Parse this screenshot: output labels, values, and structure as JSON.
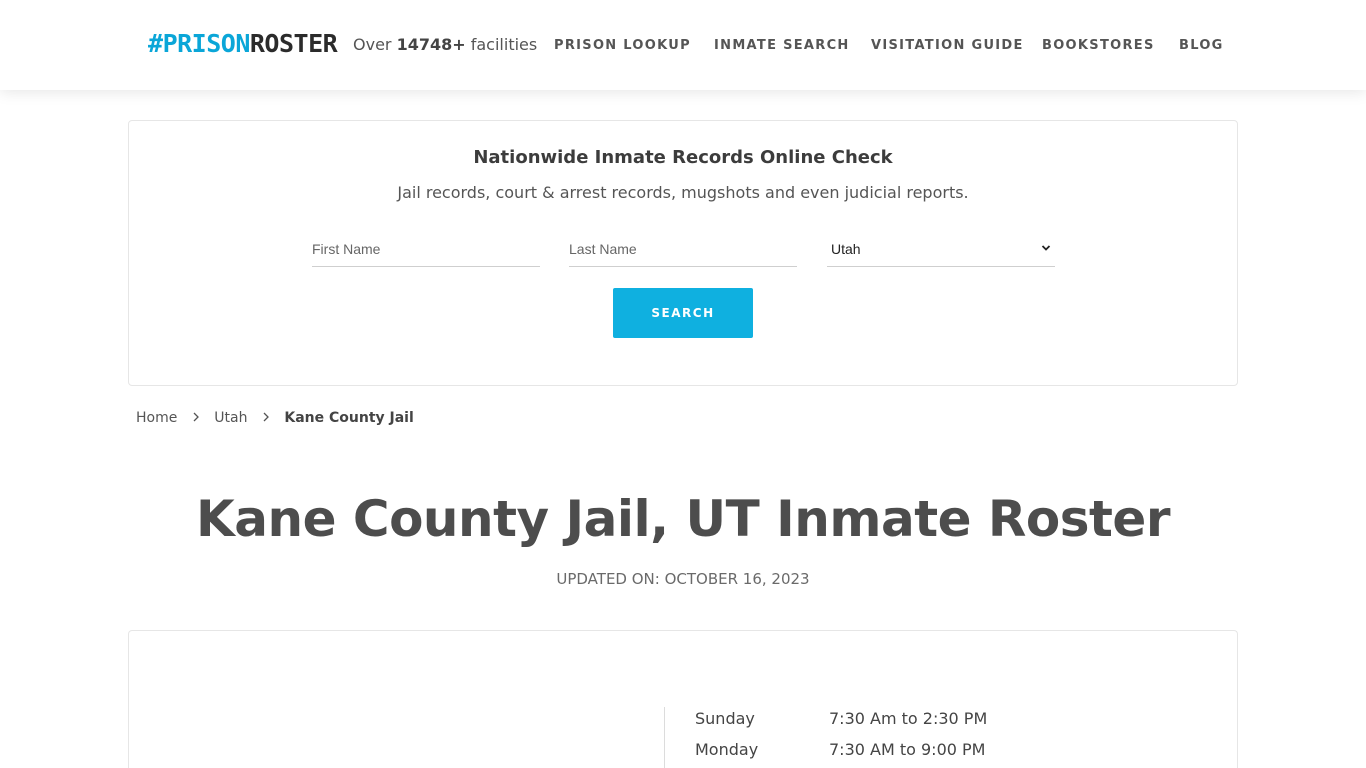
{
  "brand": {
    "hash": "#",
    "prison": "PRISON",
    "roster": "ROSTER"
  },
  "header": {
    "facilities_prefix": "Over ",
    "facilities_count": "14748+",
    "facilities_suffix": " facilities",
    "nav": [
      "PRISON LOOKUP",
      "INMATE SEARCH",
      "VISITATION GUIDE",
      "BOOKSTORES",
      "BLOG"
    ]
  },
  "search": {
    "title": "Nationwide Inmate Records Online Check",
    "subtitle": "Jail records, court & arrest records, mugshots and even judicial reports.",
    "first_name_placeholder": "First Name",
    "last_name_placeholder": "Last Name",
    "state_value": "Utah",
    "button_label": "SEARCH"
  },
  "breadcrumb": {
    "home": "Home",
    "state": "Utah",
    "current": "Kane County Jail"
  },
  "page": {
    "title": "Kane County Jail, UT Inmate Roster",
    "updated": "UPDATED ON: OCTOBER 16, 2023"
  },
  "hours": [
    {
      "day": "Sunday",
      "time": "7:30 Am to 2:30 PM"
    },
    {
      "day": "Monday",
      "time": "7:30 AM to 9:00 PM"
    }
  ],
  "colors": {
    "accent": "#0fb0e0",
    "brand_blue": "#0aa6d8",
    "text": "#4a4a4a"
  },
  "icons": {
    "breadcrumb_separator": "chevron-right-icon",
    "select_arrow": "chevron-down-icon"
  }
}
